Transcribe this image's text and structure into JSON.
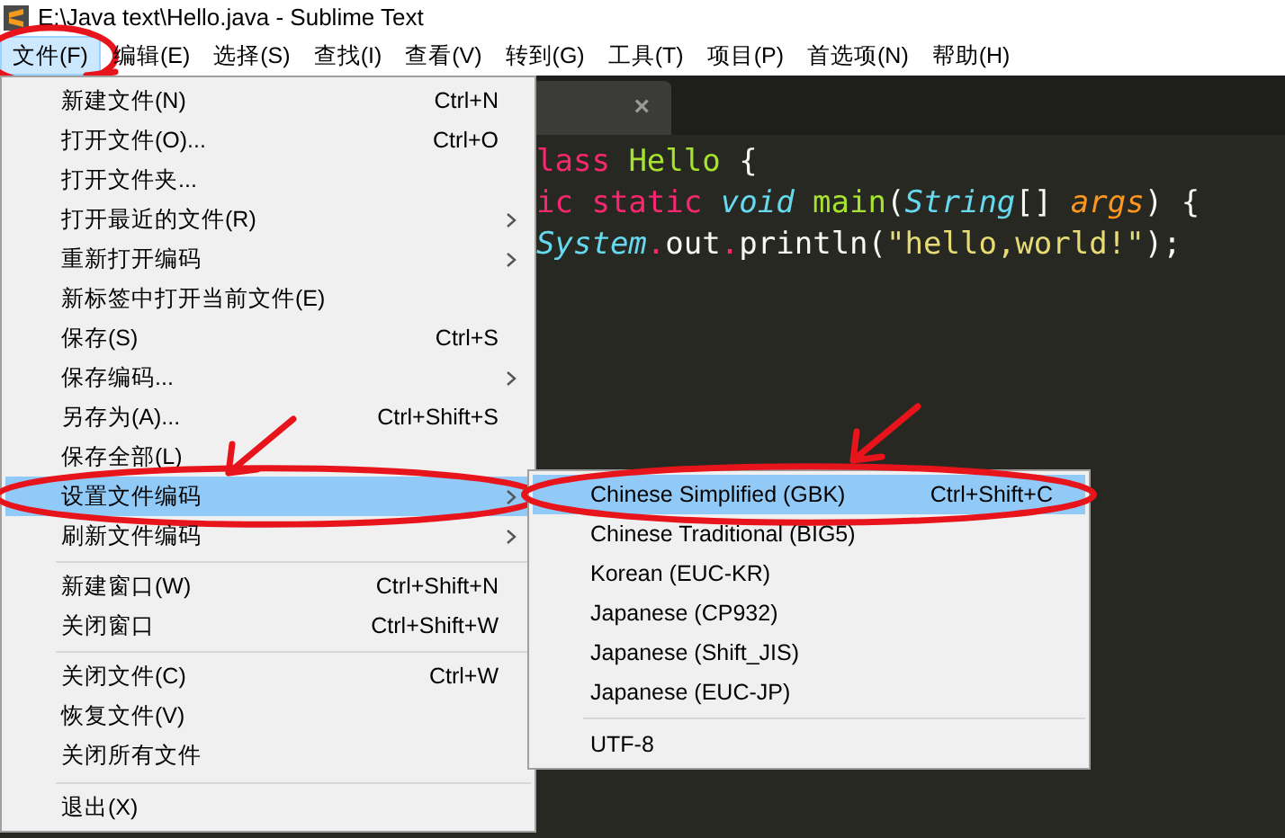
{
  "window": {
    "title": "E:\\Java text\\Hello.java - Sublime Text"
  },
  "menu_bar": [
    {
      "label": "文件(F)",
      "selected": true,
      "circled": true
    },
    {
      "label": "编辑(E)",
      "selected": false,
      "circled": false
    },
    {
      "label": "选择(S)",
      "selected": false,
      "circled": false
    },
    {
      "label": "查找(I)",
      "selected": false,
      "circled": false
    },
    {
      "label": "查看(V)",
      "selected": false,
      "circled": false
    },
    {
      "label": "转到(G)",
      "selected": false,
      "circled": false
    },
    {
      "label": "工具(T)",
      "selected": false,
      "circled": false
    },
    {
      "label": "项目(P)",
      "selected": false,
      "circled": false
    },
    {
      "label": "首选项(N)",
      "selected": false,
      "circled": false
    },
    {
      "label": "帮助(H)",
      "selected": false,
      "circled": false
    }
  ],
  "editor": {
    "tab": {
      "close": "×"
    },
    "code_lines": [
      [
        {
          "kind": "keyword",
          "text": "lass"
        },
        {
          "kind": "name",
          "text": " Hello"
        },
        {
          "kind": "plain",
          "text": " {"
        }
      ],
      [
        {
          "kind": "keyword",
          "text": "ic static "
        },
        {
          "kind": "type",
          "text": "void"
        },
        {
          "kind": "name",
          "text": " main"
        },
        {
          "kind": "plain",
          "text": "("
        },
        {
          "kind": "type",
          "text": "String"
        },
        {
          "kind": "plain",
          "text": "[] "
        },
        {
          "kind": "param",
          "text": "args"
        },
        {
          "kind": "plain",
          "text": ") {"
        }
      ],
      [
        {
          "kind": "type",
          "text": "System"
        },
        {
          "kind": "keyword",
          "text": "."
        },
        {
          "kind": "plain",
          "text": "out"
        },
        {
          "kind": "keyword",
          "text": "."
        },
        {
          "kind": "plain",
          "text": "println("
        },
        {
          "kind": "string",
          "text": "\"hello,world!\""
        },
        {
          "kind": "plain",
          "text": ");"
        }
      ]
    ]
  },
  "file_menu": {
    "items": [
      {
        "kind": "item",
        "label": "新建文件(N)",
        "shortcut": "Ctrl+N",
        "submenu": false,
        "selected": false,
        "circled": false
      },
      {
        "kind": "item",
        "label": "打开文件(O)...",
        "shortcut": "Ctrl+O",
        "submenu": false,
        "selected": false,
        "circled": false
      },
      {
        "kind": "item",
        "label": "打开文件夹...",
        "submenu": false,
        "selected": false,
        "circled": false
      },
      {
        "kind": "item",
        "label": "打开最近的文件(R)",
        "submenu": true,
        "selected": false,
        "circled": false
      },
      {
        "kind": "item",
        "label": "重新打开编码",
        "submenu": true,
        "selected": false,
        "circled": false
      },
      {
        "kind": "item",
        "label": "新标签中打开当前文件(E)",
        "submenu": false,
        "selected": false,
        "circled": false
      },
      {
        "kind": "item",
        "label": "保存(S)",
        "shortcut": "Ctrl+S",
        "submenu": false,
        "selected": false,
        "circled": false
      },
      {
        "kind": "item",
        "label": "保存编码...",
        "submenu": true,
        "selected": false,
        "circled": false
      },
      {
        "kind": "item",
        "label": "另存为(A)...",
        "shortcut": "Ctrl+Shift+S",
        "submenu": false,
        "selected": false,
        "circled": false
      },
      {
        "kind": "item",
        "label": "保存全部(L)",
        "submenu": false,
        "selected": false,
        "circled": false
      },
      {
        "kind": "item",
        "label": "设置文件编码",
        "submenu": true,
        "selected": true,
        "circled": true
      },
      {
        "kind": "item",
        "label": "刷新文件编码",
        "submenu": true,
        "selected": false,
        "circled": false
      },
      {
        "kind": "separator"
      },
      {
        "kind": "item",
        "label": "新建窗口(W)",
        "shortcut": "Ctrl+Shift+N",
        "submenu": false,
        "selected": false,
        "circled": false
      },
      {
        "kind": "item",
        "label": "关闭窗口",
        "shortcut": "Ctrl+Shift+W",
        "submenu": false,
        "selected": false,
        "circled": false
      },
      {
        "kind": "separator"
      },
      {
        "kind": "item",
        "label": "关闭文件(C)",
        "shortcut": "Ctrl+W",
        "submenu": false,
        "selected": false,
        "circled": false
      },
      {
        "kind": "item",
        "label": "恢复文件(V)",
        "submenu": false,
        "selected": false,
        "circled": false
      },
      {
        "kind": "item",
        "label": "关闭所有文件",
        "submenu": false,
        "selected": false,
        "circled": false
      },
      {
        "kind": "separator"
      },
      {
        "kind": "item",
        "label": "退出(X)",
        "submenu": false,
        "selected": false,
        "circled": false
      }
    ]
  },
  "encoding_submenu": {
    "items": [
      {
        "kind": "item",
        "label": "Chinese Simplified (GBK)",
        "shortcut": "Ctrl+Shift+C",
        "selected": true,
        "circled": true
      },
      {
        "kind": "item",
        "label": "Chinese Traditional (BIG5)",
        "selected": false,
        "circled": false
      },
      {
        "kind": "item",
        "label": "Korean (EUC-KR)",
        "selected": false,
        "circled": false
      },
      {
        "kind": "item",
        "label": "Japanese (CP932)",
        "selected": false,
        "circled": false
      },
      {
        "kind": "item",
        "label": "Japanese (Shift_JIS)",
        "selected": false,
        "circled": false
      },
      {
        "kind": "item",
        "label": "Japanese (EUC-JP)",
        "selected": false,
        "circled": false
      },
      {
        "kind": "separator"
      },
      {
        "kind": "item",
        "label": "UTF-8",
        "selected": false,
        "circled": false
      }
    ]
  }
}
